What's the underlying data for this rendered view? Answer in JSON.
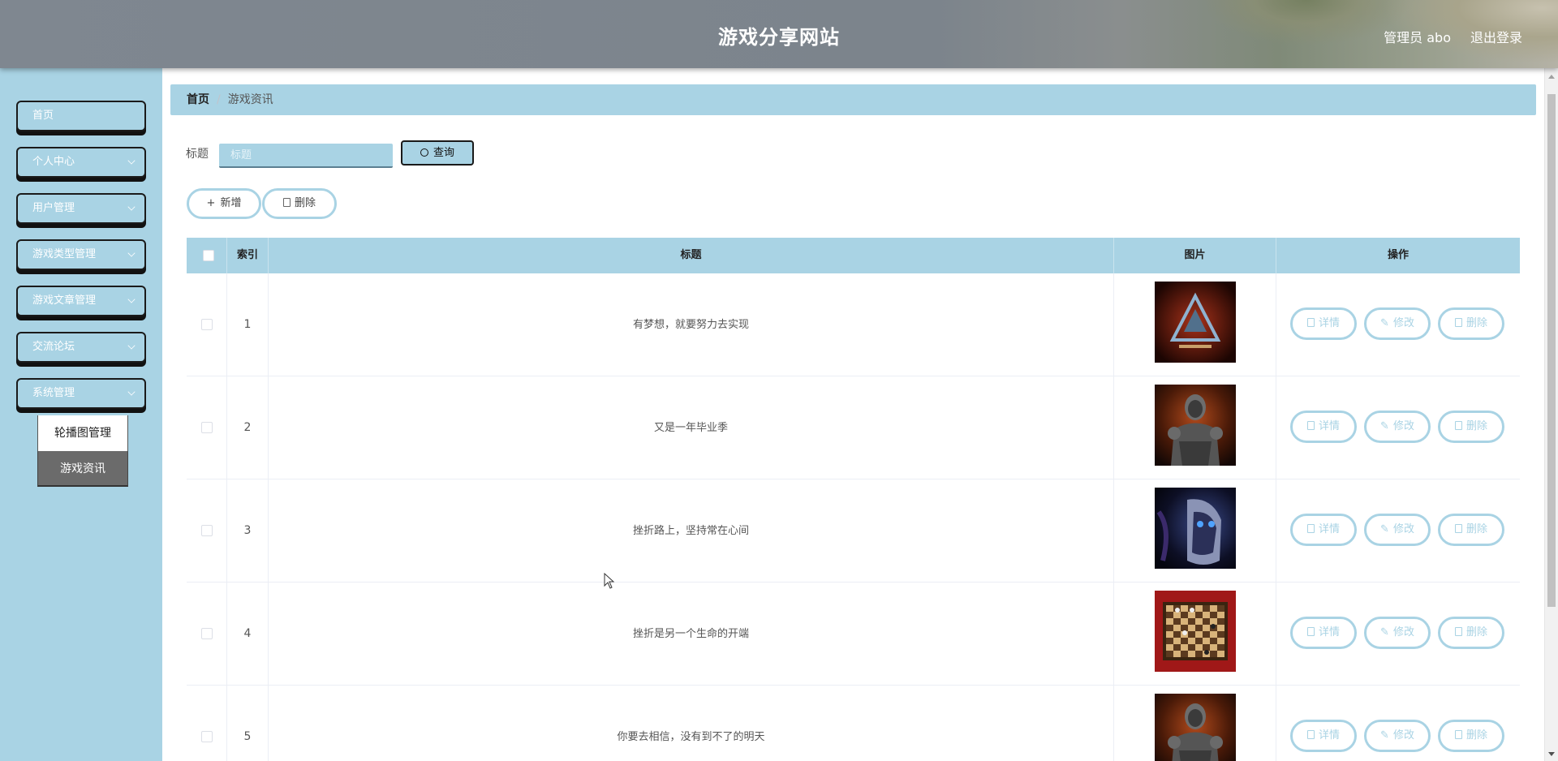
{
  "header": {
    "title": "游戏分享网站",
    "user": "管理员 abo",
    "logout": "退出登录"
  },
  "sidebar": {
    "items": [
      {
        "label": "首页",
        "has_arrow": false
      },
      {
        "label": "个人中心",
        "has_arrow": true
      },
      {
        "label": "用户管理",
        "has_arrow": true
      },
      {
        "label": "游戏类型管理",
        "has_arrow": true
      },
      {
        "label": "游戏文章管理",
        "has_arrow": true
      },
      {
        "label": "交流论坛",
        "has_arrow": true
      },
      {
        "label": "系统管理",
        "has_arrow": true
      }
    ],
    "submenu": [
      {
        "label": "轮播图管理",
        "active": false
      },
      {
        "label": "游戏资讯",
        "active": true
      }
    ]
  },
  "breadcrumb": {
    "home": "首页",
    "separator": "/",
    "current": "游戏资讯"
  },
  "search": {
    "label": "标题",
    "placeholder": "标题",
    "value": "",
    "button": "查询"
  },
  "toolbar": {
    "add": "新增",
    "delete": "删除"
  },
  "table": {
    "columns": [
      "",
      "索引",
      "标题",
      "图片",
      "操作"
    ],
    "rows": [
      {
        "index": "1",
        "title": "有梦想，就要努力去实现",
        "image": "red-triangle-logo"
      },
      {
        "index": "2",
        "title": "又是一年毕业季",
        "image": "armored-soldier"
      },
      {
        "index": "3",
        "title": "挫折路上，坚持常在心间",
        "image": "blue-eyed-knight"
      },
      {
        "index": "4",
        "title": "挫折是另一个生命的开端",
        "image": "chess-board"
      },
      {
        "index": "5",
        "title": "你要去相信，没有到不了的明天",
        "image": "armored-soldier"
      }
    ],
    "row_actions": {
      "detail": "详情",
      "edit": "修改",
      "delete": "删除"
    }
  },
  "colors": {
    "accent": "#a9d3e4",
    "header_bg": "#7f8790",
    "active_submenu": "#6b6b6b"
  }
}
